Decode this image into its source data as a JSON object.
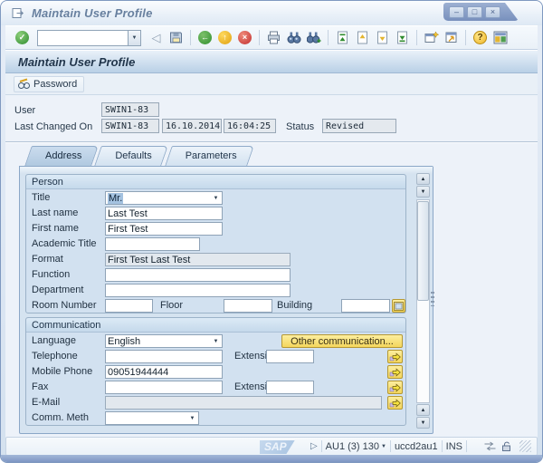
{
  "window": {
    "title": "Maintain User Profile"
  },
  "glyphs": {
    "minimize": "–",
    "maximize": "□",
    "close": "×",
    "enter_check": "✓",
    "back_triangle": "◁",
    "back_arrow": "←",
    "exit_arrow": "↑",
    "cancel_x": "×",
    "dropdown_arrow": "▼",
    "scroll_up": "▲",
    "scroll_down": "▼",
    "help_mark": "?",
    "status_triangle": "▷",
    "system_caret": "▼"
  },
  "toolbar": {
    "command_value": ""
  },
  "screen": {
    "title": "Maintain User Profile",
    "password_button": "Password"
  },
  "header": {
    "user_label": "User",
    "user_value": "SWIN1-83",
    "last_changed_label": "Last Changed On",
    "last_changed_user": "SWIN1-83",
    "last_changed_date": "16.10.2014",
    "last_changed_time": "16:04:25",
    "status_label": "Status",
    "status_value": "Revised"
  },
  "tabs": {
    "address": "Address",
    "defaults": "Defaults",
    "parameters": "Parameters"
  },
  "person": {
    "header": "Person",
    "title_label": "Title",
    "title_value": "Mr.",
    "last_name_label": "Last name",
    "last_name_value": "Last Test",
    "first_name_label": "First name",
    "first_name_value": "First Test",
    "academic_title_label": "Academic Title",
    "academic_title_value": "",
    "format_label": "Format",
    "format_value": "First Test Last Test",
    "function_label": "Function",
    "function_value": "",
    "department_label": "Department",
    "department_value": "",
    "room_number_label": "Room Number",
    "room_number_value": "",
    "floor_label": "Floor",
    "floor_value": "",
    "building_label": "Building",
    "building_value": ""
  },
  "communication": {
    "header": "Communication",
    "language_label": "Language",
    "language_value": "English",
    "other_communication_button": "Other communication...",
    "telephone_label": "Telephone",
    "telephone_value": "",
    "telephone_extension_label": "Extension",
    "telephone_extension_value": "",
    "mobile_phone_label": "Mobile Phone",
    "mobile_phone_value": "09051944444",
    "fax_label": "Fax",
    "fax_value": "",
    "fax_extension_label": "Extension",
    "fax_extension_value": "",
    "email_label": "E-Mail",
    "email_value": "",
    "comm_meth_label": "Comm. Meth",
    "comm_meth_value": ""
  },
  "statusbar": {
    "sap_logo": "SAP",
    "system": "AU1 (3) 130",
    "host": "uccd2au1",
    "insert_mode": "INS"
  }
}
